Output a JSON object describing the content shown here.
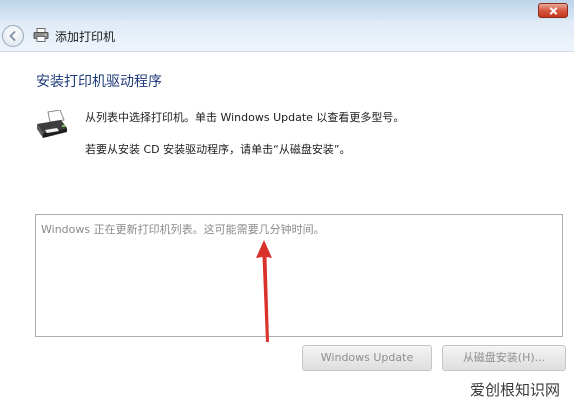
{
  "window": {
    "title": "添加打印机"
  },
  "page": {
    "heading": "安装打印机驱动程序",
    "instruction_1": "从列表中选择打印机。单击 Windows Update 以查看更多型号。",
    "instruction_2": "若要从安装 CD 安装驱动程序，请单击“从磁盘安装”。"
  },
  "printer_list": {
    "status_text": "Windows 正在更新打印机列表。这可能需要几分钟时间。"
  },
  "buttons": {
    "windows_update": "Windows Update",
    "have_disk": "从磁盘安装(H)..."
  },
  "watermark": {
    "text": "爱创根知识网"
  },
  "icons": {
    "back": "back-arrow-icon",
    "printer": "printer-icon",
    "close": "close-icon",
    "annotation": "red-arrow-annotation-icon"
  },
  "colors": {
    "heading": "#1f3a7a",
    "annotation_arrow": "#d8322b",
    "close_button": "#c3381f",
    "disabled_text": "#8f8f8f"
  }
}
